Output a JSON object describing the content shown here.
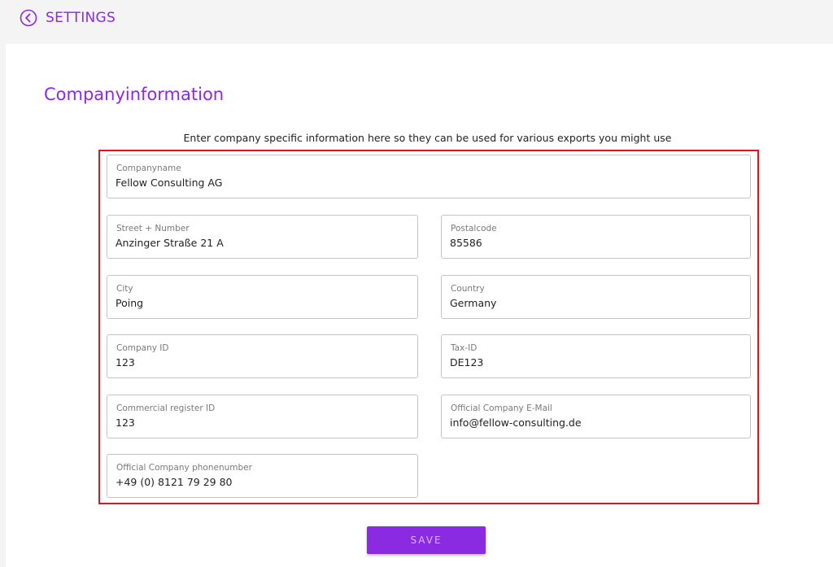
{
  "header": {
    "back_icon": "chevron-left-circle-icon",
    "title": "SETTINGS"
  },
  "page": {
    "title": "Companyinformation",
    "description": "Enter company specific information here so they can be used for various exports you might use"
  },
  "form": {
    "company_name": {
      "label": "Companyname",
      "value": "Fellow Consulting AG"
    },
    "street": {
      "label": "Street + Number",
      "value": "Anzinger Straße 21 A"
    },
    "postal_code": {
      "label": "Postalcode",
      "value": "85586"
    },
    "city": {
      "label": "City",
      "value": "Poing"
    },
    "country": {
      "label": "Country",
      "value": "Germany"
    },
    "company_id": {
      "label": "Company ID",
      "value": "123"
    },
    "tax_id": {
      "label": "Tax-ID",
      "value": "DE123"
    },
    "commercial_register_id": {
      "label": "Commercial register ID",
      "value": "123"
    },
    "email": {
      "label": "Official Company E-Mail",
      "value": "info@fellow-consulting.de"
    },
    "phone": {
      "label": "Official Company phonenumber",
      "value": "+49 (0) 8121 79 29 80"
    }
  },
  "actions": {
    "save_label": "SAVE"
  },
  "colors": {
    "accent": "#8a2be2",
    "highlight_frame": "#e0141c"
  }
}
